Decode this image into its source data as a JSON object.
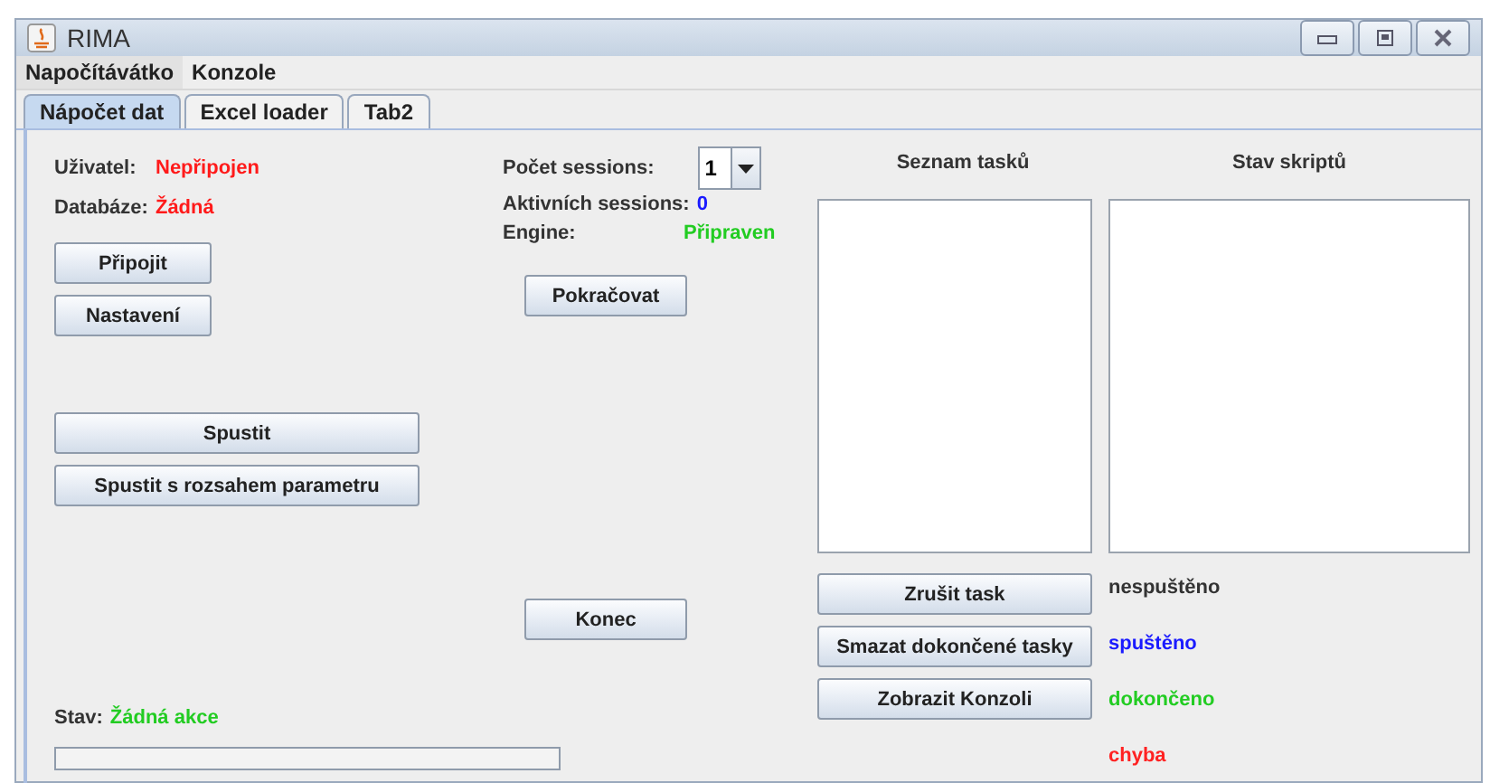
{
  "window": {
    "title": "RIMA"
  },
  "menu": [
    {
      "label": "Napočítávátko",
      "selected": true
    },
    {
      "label": "Konzole",
      "selected": false
    }
  ],
  "tabs": [
    {
      "label": "Nápočet dat",
      "selected": true
    },
    {
      "label": "Excel loader",
      "selected": false
    },
    {
      "label": "Tab2",
      "selected": false
    }
  ],
  "connection": {
    "user_label": "Uživatel:",
    "user_value": "Nepřipojen",
    "database_label": "Databáze:",
    "database_value": "Žádná"
  },
  "left_buttons": [
    "Připojit",
    "Nastavení"
  ],
  "run_buttons": [
    "Spustit",
    "Spustit s rozsahem parametru"
  ],
  "sessions": {
    "count_label": "Počet sessions:",
    "count_value": "1",
    "active_label": "Aktivních sessions:",
    "active_value": "0",
    "engine_label": "Engine:",
    "engine_value": "Připraven"
  },
  "continue_button": "Pokračovat",
  "end_button": "Konec",
  "status": {
    "label": "Stav:",
    "value": "Žádná akce",
    "progress": {
      "level": 0
    }
  },
  "task_list": {
    "heading": "Seznam tasků"
  },
  "script_list": {
    "heading": "Stav skriptů"
  },
  "task_buttons": [
    "Zrušit task",
    "Smazat dokončené tasky",
    "Zobrazit Konzoli"
  ],
  "legend": [
    {
      "label": "nespuštěno",
      "color": "#333333"
    },
    {
      "label": "spuštěno",
      "color": "#1a1aff"
    },
    {
      "label": "dokončeno",
      "color": "#22cc22"
    },
    {
      "label": "chyba",
      "color": "#ff2222"
    }
  ]
}
